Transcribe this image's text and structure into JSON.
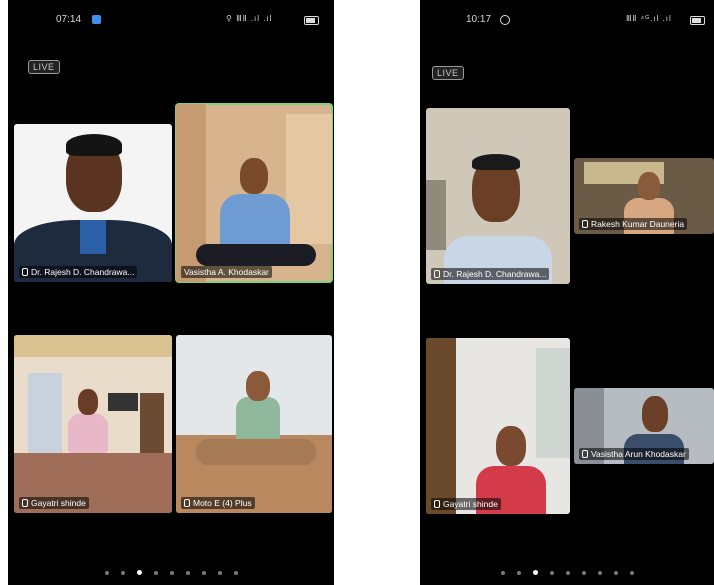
{
  "left_phone": {
    "time": "07:14",
    "status_icons": "⚲ ⅢⅡ .ıl .ıl",
    "live_badge": "LIVE",
    "tiles": [
      {
        "name": "Dr. Rajesh D. Chandrawa...",
        "active": false
      },
      {
        "name": "Vasistha A. Khodaskar",
        "active": true
      },
      {
        "name": "Gayatri shinde",
        "active": false
      },
      {
        "name": "Moto E (4) Plus",
        "active": false
      }
    ],
    "page_dots": 10,
    "active_dot": 2
  },
  "right_phone": {
    "time": "10:17",
    "status_icons": "ⅢⅡ ⁴ᴳ.ıl .ıl",
    "live_badge": "LIVE",
    "tiles": [
      {
        "name": "Dr. Rajesh D. Chandrawa...",
        "active": false
      },
      {
        "name": "Rakesh Kumar Dauneria",
        "active": false
      },
      {
        "name": "Gayatri shinde",
        "active": false
      },
      {
        "name": "Vasistha Arun Khodaskar",
        "active": false
      }
    ],
    "page_dots": 10,
    "active_dot": 2
  },
  "colors": {
    "background": "#000000",
    "active_border": "#7bd27b",
    "label_text": "#ffffff"
  },
  "icons": [
    "wifi-icon",
    "signal-icon",
    "battery-icon",
    "whatsapp-icon",
    "mic-icon",
    "settings-icon"
  ]
}
